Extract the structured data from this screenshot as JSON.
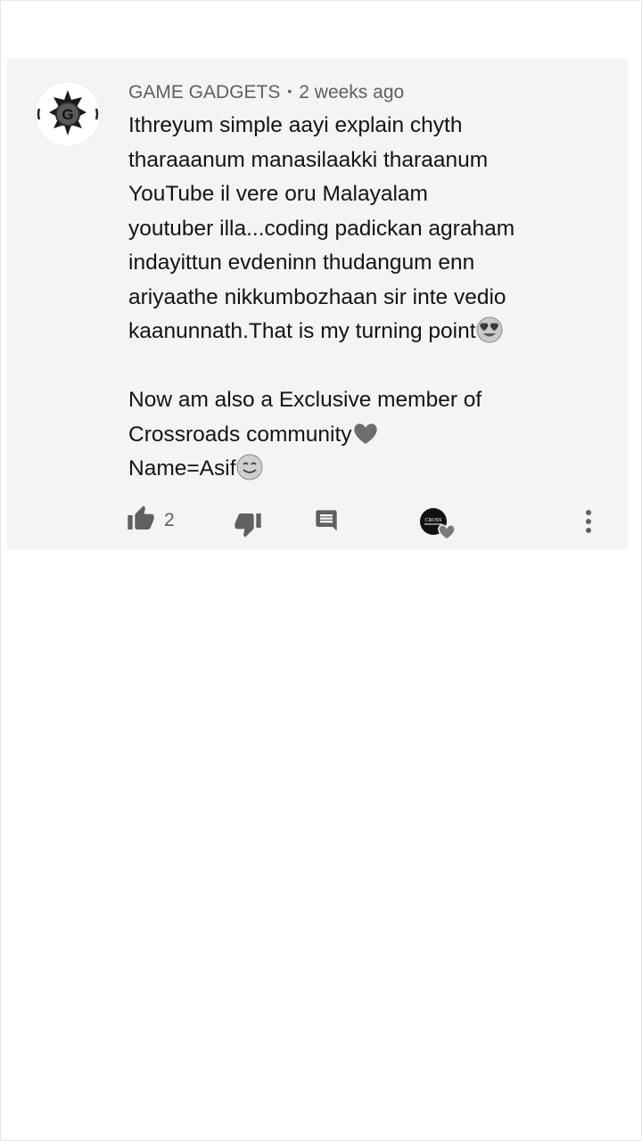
{
  "comment": {
    "author": "GAME GADGETS",
    "separator": "•",
    "time": "2 weeks ago",
    "lines": [
      "Ithreyum simple aayi explain chyth",
      "tharaaanum manasilaakki tharaanum",
      "YouTube il vere oru Malayalam",
      "youtuber illa...coding padickan agraham",
      "indayittun evdeninn thudangum enn",
      "ariyaathe nikkumbozhaan sir inte vedio",
      "kaanunnath.That is my turning point",
      "Now am also a Exclusive member of",
      "Crossroads community",
      "Name=Asif"
    ],
    "avatar_letter": "G",
    "like_count": "2",
    "creator_heart_badge_text": "CROSS"
  },
  "icons": {
    "avatar": "game-gadgets-avatar",
    "heart_eyes": "heart-eyes-emoji",
    "heart": "heart-emoji",
    "smile": "smiling-face-emoji",
    "like": "thumbs-up-icon",
    "dislike": "thumbs-down-icon",
    "reply": "reply-icon",
    "creator_heart": "creator-heart-badge",
    "more": "more-vert-icon"
  },
  "colors": {
    "card_bg": "#f4f4f4",
    "text": "#141414",
    "meta": "#606060",
    "icon": "#606060"
  }
}
